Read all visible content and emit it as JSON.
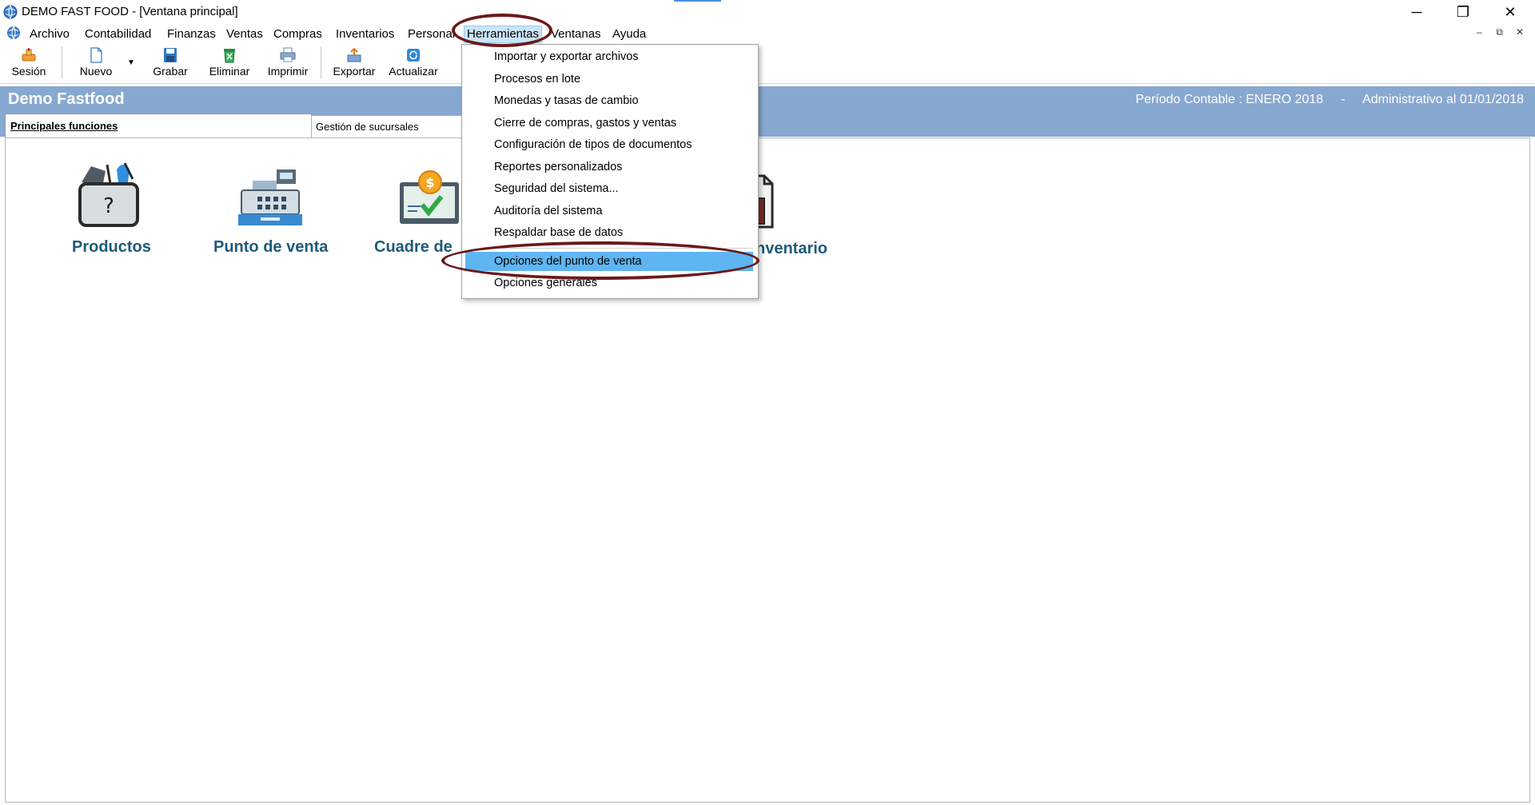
{
  "window": {
    "title": "DEMO FAST FOOD - [Ventana principal]",
    "minimize": "─",
    "restore": "❐",
    "close": "✕"
  },
  "menubar": {
    "items": [
      "Archivo",
      "Contabilidad",
      "Finanzas",
      "Ventas",
      "Compras",
      "Inventarios",
      "Personal",
      "Herramientas",
      "Ventanas",
      "Ayuda"
    ],
    "mdi_minimize": "–",
    "mdi_restore": "⧉",
    "mdi_close": "✕"
  },
  "toolbar": {
    "sesion": "Sesión",
    "nuevo": "Nuevo",
    "grabar": "Grabar",
    "eliminar": "Eliminar",
    "imprimir": "Imprimir",
    "exportar": "Exportar",
    "actualizar": "Actualizar"
  },
  "header": {
    "company": "Demo Fastfood",
    "period": "Período Contable : ENERO 2018     -     Administrativo al 01/01/2018"
  },
  "tabs": {
    "main": "Principales funciones",
    "branches": "Gestión de sucursales"
  },
  "functions": {
    "productos": "Productos",
    "punto_venta": "Punto de venta",
    "cuadre": "Cuadre de",
    "inventario": "nventario"
  },
  "dropdown": {
    "items": [
      "Importar y exportar archivos",
      "Procesos en lote",
      "Monedas y tasas de cambio",
      "Cierre de compras, gastos y ventas",
      "Configuración de tipos de documentos",
      "Reportes personalizados",
      "Seguridad del sistema...",
      "Auditoría del sistema",
      "Respaldar base de datos",
      "Opciones del punto de venta",
      "Opciones generales"
    ],
    "highlighted_index": 9
  },
  "colors": {
    "header_blue": "#87a8d0",
    "highlight": "#5fb5f1",
    "annotation": "#6a1a1a",
    "function_label": "#1e5a78"
  }
}
